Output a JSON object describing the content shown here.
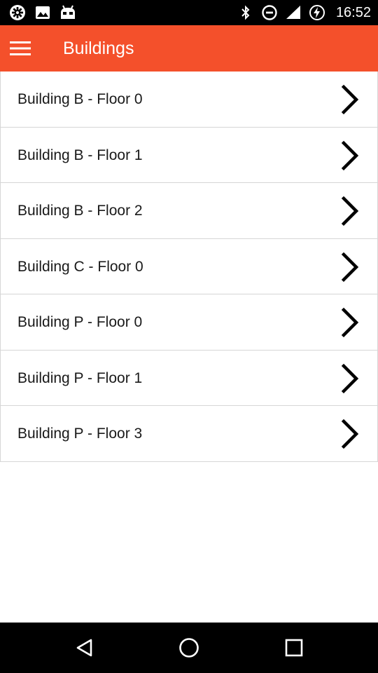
{
  "status_bar": {
    "time": "16:52",
    "left_icons": [
      "settings-gear-icon",
      "image-icon",
      "android-robot-icon"
    ],
    "right_icons": [
      "bluetooth-icon",
      "do-not-disturb-icon",
      "signal-icon",
      "battery-charging-icon"
    ]
  },
  "toolbar": {
    "title": "Buildings",
    "background_color": "#f4502b",
    "menu_icon": "hamburger-menu-icon"
  },
  "buildings": {
    "items": [
      {
        "label": "Building B - Floor 0"
      },
      {
        "label": "Building B - Floor 1"
      },
      {
        "label": "Building B - Floor 2"
      },
      {
        "label": "Building C - Floor 0"
      },
      {
        "label": "Building P - Floor 0"
      },
      {
        "label": "Building P - Floor 1"
      },
      {
        "label": "Building P - Floor 3"
      }
    ],
    "item_icon": "chevron-right-icon"
  },
  "nav_bar": {
    "buttons": [
      "back-triangle-icon",
      "home-circle-icon",
      "recents-square-icon"
    ]
  }
}
